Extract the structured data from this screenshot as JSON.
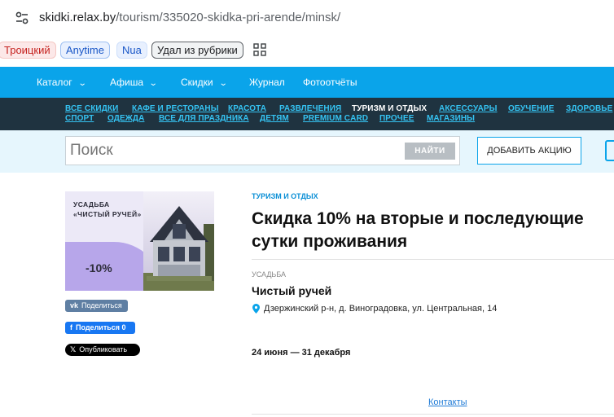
{
  "browser": {
    "url_host": "skidki.relax.by",
    "url_path": "/tourism/335020-skidka-pri-arende/minsk/"
  },
  "bookmarks": [
    "Троицкий",
    "Anytime",
    "Nua",
    "Удал из рубрики"
  ],
  "topnav": [
    {
      "label": "Каталог",
      "has_dropdown": true
    },
    {
      "label": "Афиша",
      "has_dropdown": true
    },
    {
      "label": "Скидки",
      "has_dropdown": true
    },
    {
      "label": "Журнал",
      "has_dropdown": false
    },
    {
      "label": "Фотоотчёты",
      "has_dropdown": false
    }
  ],
  "categories": {
    "row1": [
      "Все скидки",
      "Кафе и рестораны",
      "Красота",
      "Развлечения",
      "Туризм и отдых",
      "Аксессуары",
      "Обучение",
      "Здоровье"
    ],
    "row2": [
      "Спорт",
      "Одежда",
      "Все для праздника",
      "Детям",
      "Premium card",
      "Прочее",
      "Магазины"
    ],
    "active": "Туризм и отдых"
  },
  "search": {
    "placeholder": "Поиск",
    "button": "НАЙТИ",
    "add_button": "ДОБАВИТЬ АКЦИЮ"
  },
  "promo": {
    "title": "УСАДЬБА\n«ЧИСТЫЙ РУЧЕЙ»",
    "discount": "-10%"
  },
  "share": {
    "vk": "Поделиться",
    "fb": "Поделиться 0",
    "x": "Опубликовать"
  },
  "deal": {
    "category": "ТУРИЗМ И ОТДЫХ",
    "title": "Скидка 10% на вторые и последующие сутки проживания",
    "type": "УСАДЬБА",
    "name": "Чистый ручей",
    "address": "Дзержинский р-н, д. Виноградовка, ул. Центральная, 14",
    "dates": "24 июня — 31 декабря",
    "contacts": "Контакты"
  },
  "colors": {
    "accent_blue": "#0aa4ea",
    "dark_bar": "#1f3340",
    "category_link": "#35c3f2"
  }
}
